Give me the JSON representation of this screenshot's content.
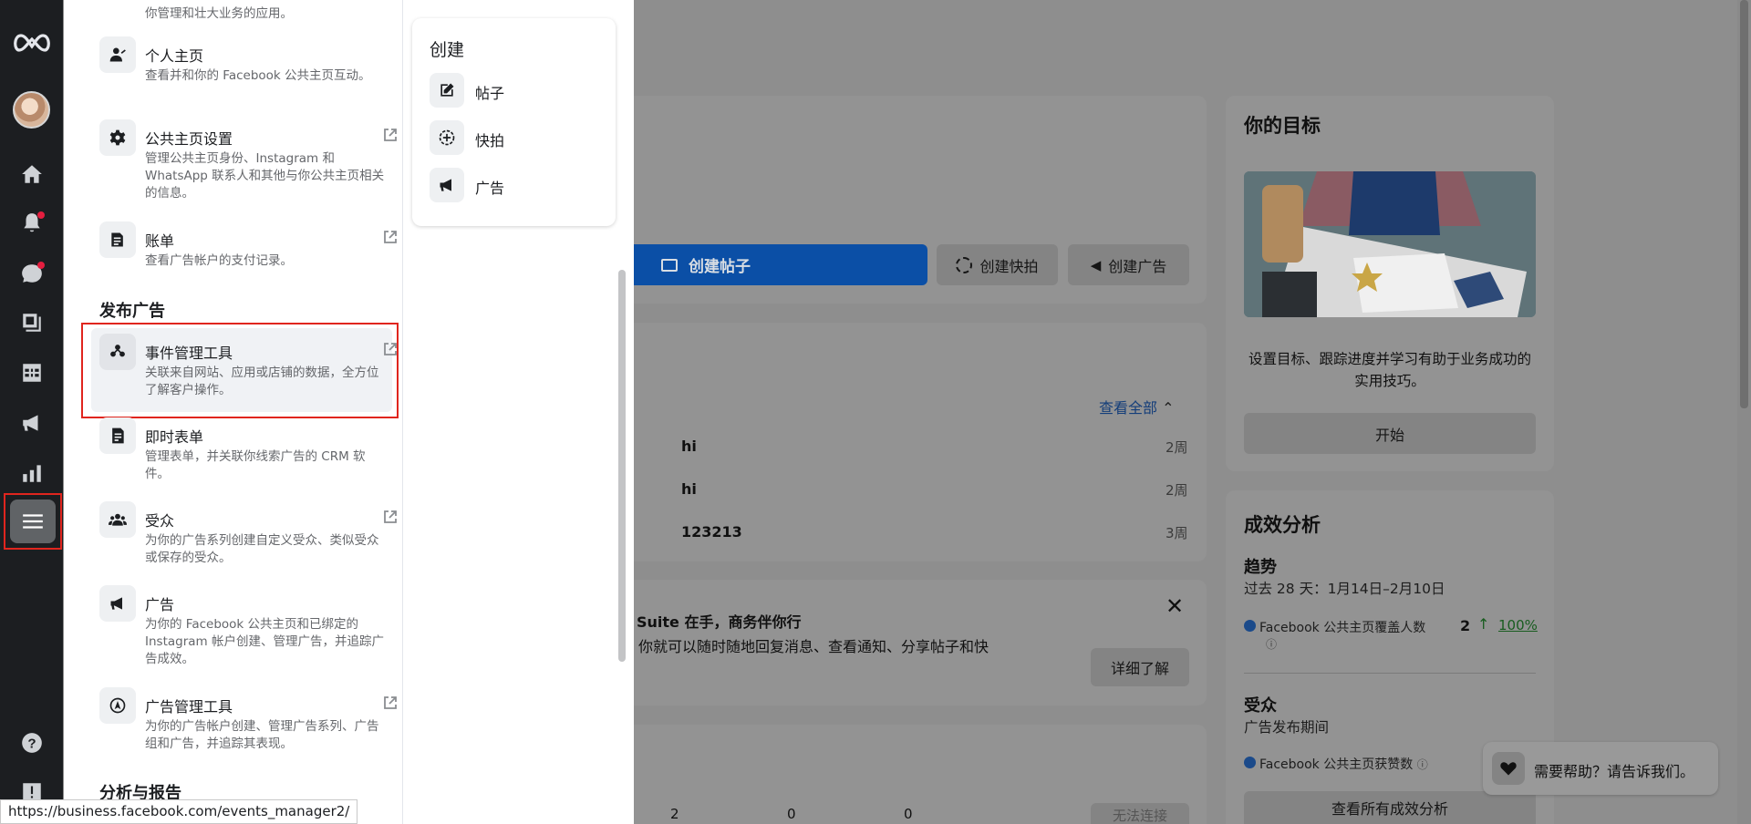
{
  "menu": {
    "partial_top_desc": "你管理和壮大业务的应用。",
    "items": [
      {
        "title": "个人主页",
        "desc": "查看并和你的 Facebook 公共主页互动。",
        "external": false
      },
      {
        "title": "公共主页设置",
        "desc": "管理公共主页身份、Instagram 和 WhatsApp 联系人和其他与你公共主页相关的信息。",
        "external": true
      },
      {
        "title": "账单",
        "desc": "查看广告帐户的支付记录。",
        "external": true
      }
    ],
    "section_ads": "发布广告",
    "ad_items": [
      {
        "title": "事件管理工具",
        "desc": "关联来自网站、应用或店铺的数据，全方位了解客户操作。",
        "external": true
      },
      {
        "title": "即时表单",
        "desc": "管理表单，并关联你线索广告的 CRM 软件。",
        "external": false
      },
      {
        "title": "受众",
        "desc": "为你的广告系列创建自定义受众、类似受众或保存的受众。",
        "external": true
      },
      {
        "title": "广告",
        "desc": "为你的 Facebook 公共主页和已绑定的 Instagram 帐户创建、管理广告，并追踪广告成效。",
        "external": false
      },
      {
        "title": "广告管理工具",
        "desc": "为你的广告帐户创建、管理广告系列、广告组和广告，并追踪其表现。",
        "external": true
      }
    ],
    "section_analytics": "分析与报告"
  },
  "create": {
    "title": "创建",
    "items": [
      {
        "label": "帖子",
        "icon": "edit-icon"
      },
      {
        "label": "快拍",
        "icon": "story-add-icon"
      },
      {
        "label": "广告",
        "icon": "megaphone-icon"
      }
    ]
  },
  "main": {
    "create_post": "创建帖子",
    "create_story": "创建快拍",
    "create_ad": "创建广告",
    "view_all": "查看全部",
    "rows": [
      {
        "value": "hi",
        "time": "2周"
      },
      {
        "value": "hi",
        "time": "2周"
      },
      {
        "value": "123213",
        "time": "3周"
      }
    ],
    "promo_title": "Suite 在手，商务伴你行",
    "promo_desc": "你就可以随时随地回复消息、查看通知、分享帖子和快",
    "learn_more": "详细了解",
    "bottom_nums": [
      "2",
      "0",
      "0"
    ],
    "bottom_btn": "无法连接"
  },
  "goal": {
    "title": "你的目标",
    "desc": "设置目标、跟踪进度并学习有助于业务成功的实用技巧。",
    "start": "开始"
  },
  "insights": {
    "title": "成效分析",
    "trend_title": "趋势",
    "trend_range": "过去 28 天：1月14日–2月10日",
    "reach_label": "Facebook 公共主页覆盖人数",
    "reach_value": "2",
    "reach_change": "100%",
    "audience_title": "受众",
    "audience_sub": "广告发布期间",
    "likes_label": "Facebook 公共主页获赞数",
    "view_all": "查看所有成效分析"
  },
  "help": {
    "label": "需要帮助？请告诉我们。"
  },
  "status_url": "https://business.facebook.com/events_manager2/"
}
